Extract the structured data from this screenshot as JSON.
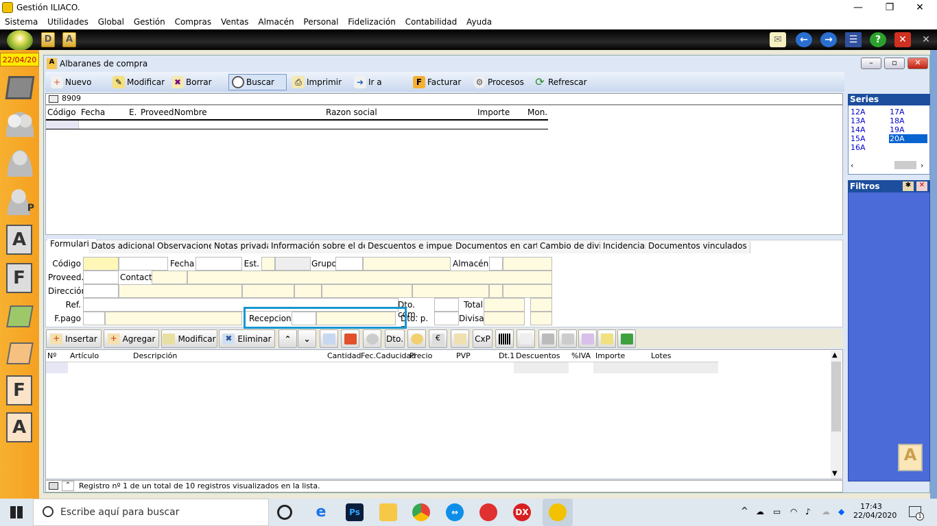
{
  "app": {
    "title": "Gestión ILIACO."
  },
  "window_controls": {
    "minimize": "—",
    "restore": "❐",
    "close": "✕"
  },
  "menu": [
    "Sistema",
    "Utilidades",
    "Global",
    "Gestión",
    "Compras",
    "Ventas",
    "Almacén",
    "Personal",
    "Fidelización",
    "Contabilidad",
    "Ayuda"
  ],
  "quickbar": {
    "d_label": "D",
    "a_label": "A"
  },
  "leftbar": {
    "date": "22/04/20",
    "letter_a": "A",
    "letter_f": "F",
    "letter_f2": "F",
    "letter_a2": "A",
    "p_badge": "P"
  },
  "document": {
    "title": "Albaranes de compra",
    "toolbar": [
      "Nuevo",
      "Modificar",
      "Borrar",
      "Buscar",
      "Imprimir",
      "Ir a",
      "Facturar",
      "Procesos",
      "Refrescar"
    ],
    "search_value": "8909",
    "list_columns": [
      "Código",
      "Fecha",
      "E.",
      "Proveed.",
      "Nombre",
      "Razon social",
      "Importe",
      "Mon."
    ]
  },
  "series": {
    "title": "Series",
    "items": [
      "12A",
      "17A",
      "13A",
      "18A",
      "14A",
      "19A",
      "15A",
      "20A",
      "16A"
    ],
    "selected": "20A"
  },
  "filtros": {
    "title": "Filtros"
  },
  "tabs": [
    "Formulario",
    "Datos adicionales",
    "Observaciones",
    "Notas privadas",
    "Información sobre el detalle",
    "Descuentos e impuestos",
    "Documentos en cartera",
    "Cambio de divisa",
    "Incidencias",
    "Documentos vinculados"
  ],
  "form": {
    "codigo": "Código",
    "fecha": "Fecha",
    "est": "Est.",
    "grupo": "Grupo",
    "almacen": "Almacén",
    "proveed": "Proveed.",
    "contacto": "Contacto",
    "direccion": "Dirección",
    "ref": "Ref.",
    "dto_com": "Dto. com.",
    "total": "Total",
    "fpago": "F.pago",
    "recepciona": "Recepciona",
    "dto_pp": "Dto. p. p.",
    "divisa": "Divisa"
  },
  "detail_buttons": {
    "insertar": "Insertar",
    "agregar": "Agregar",
    "modificar": "Modificar",
    "eliminar": "Eliminar",
    "dto": "Dto.",
    "cxp": "CxP"
  },
  "detail_columns": [
    "Nº",
    "Artículo",
    "Descripción",
    "Cantidad",
    "Fec.Caducidad",
    "Precio",
    "PVP",
    "Dt.1",
    "Descuentos",
    "%IVA",
    "Importe",
    "Lotes"
  ],
  "status": {
    "text": "Registro nº 1 de un total de 10 registros visualizados en la lista."
  },
  "taskbar": {
    "search_placeholder": "Escribe aquí para buscar",
    "time": "17:43",
    "date": "22/04/2020",
    "ps": "Ps",
    "dx": "DX",
    "notif_count": "1"
  },
  "colors": {
    "accent": "#1596d0",
    "series_header": "#1d4e9e",
    "leftbar": "#f5a020",
    "field_fill": "#fffbe0"
  }
}
